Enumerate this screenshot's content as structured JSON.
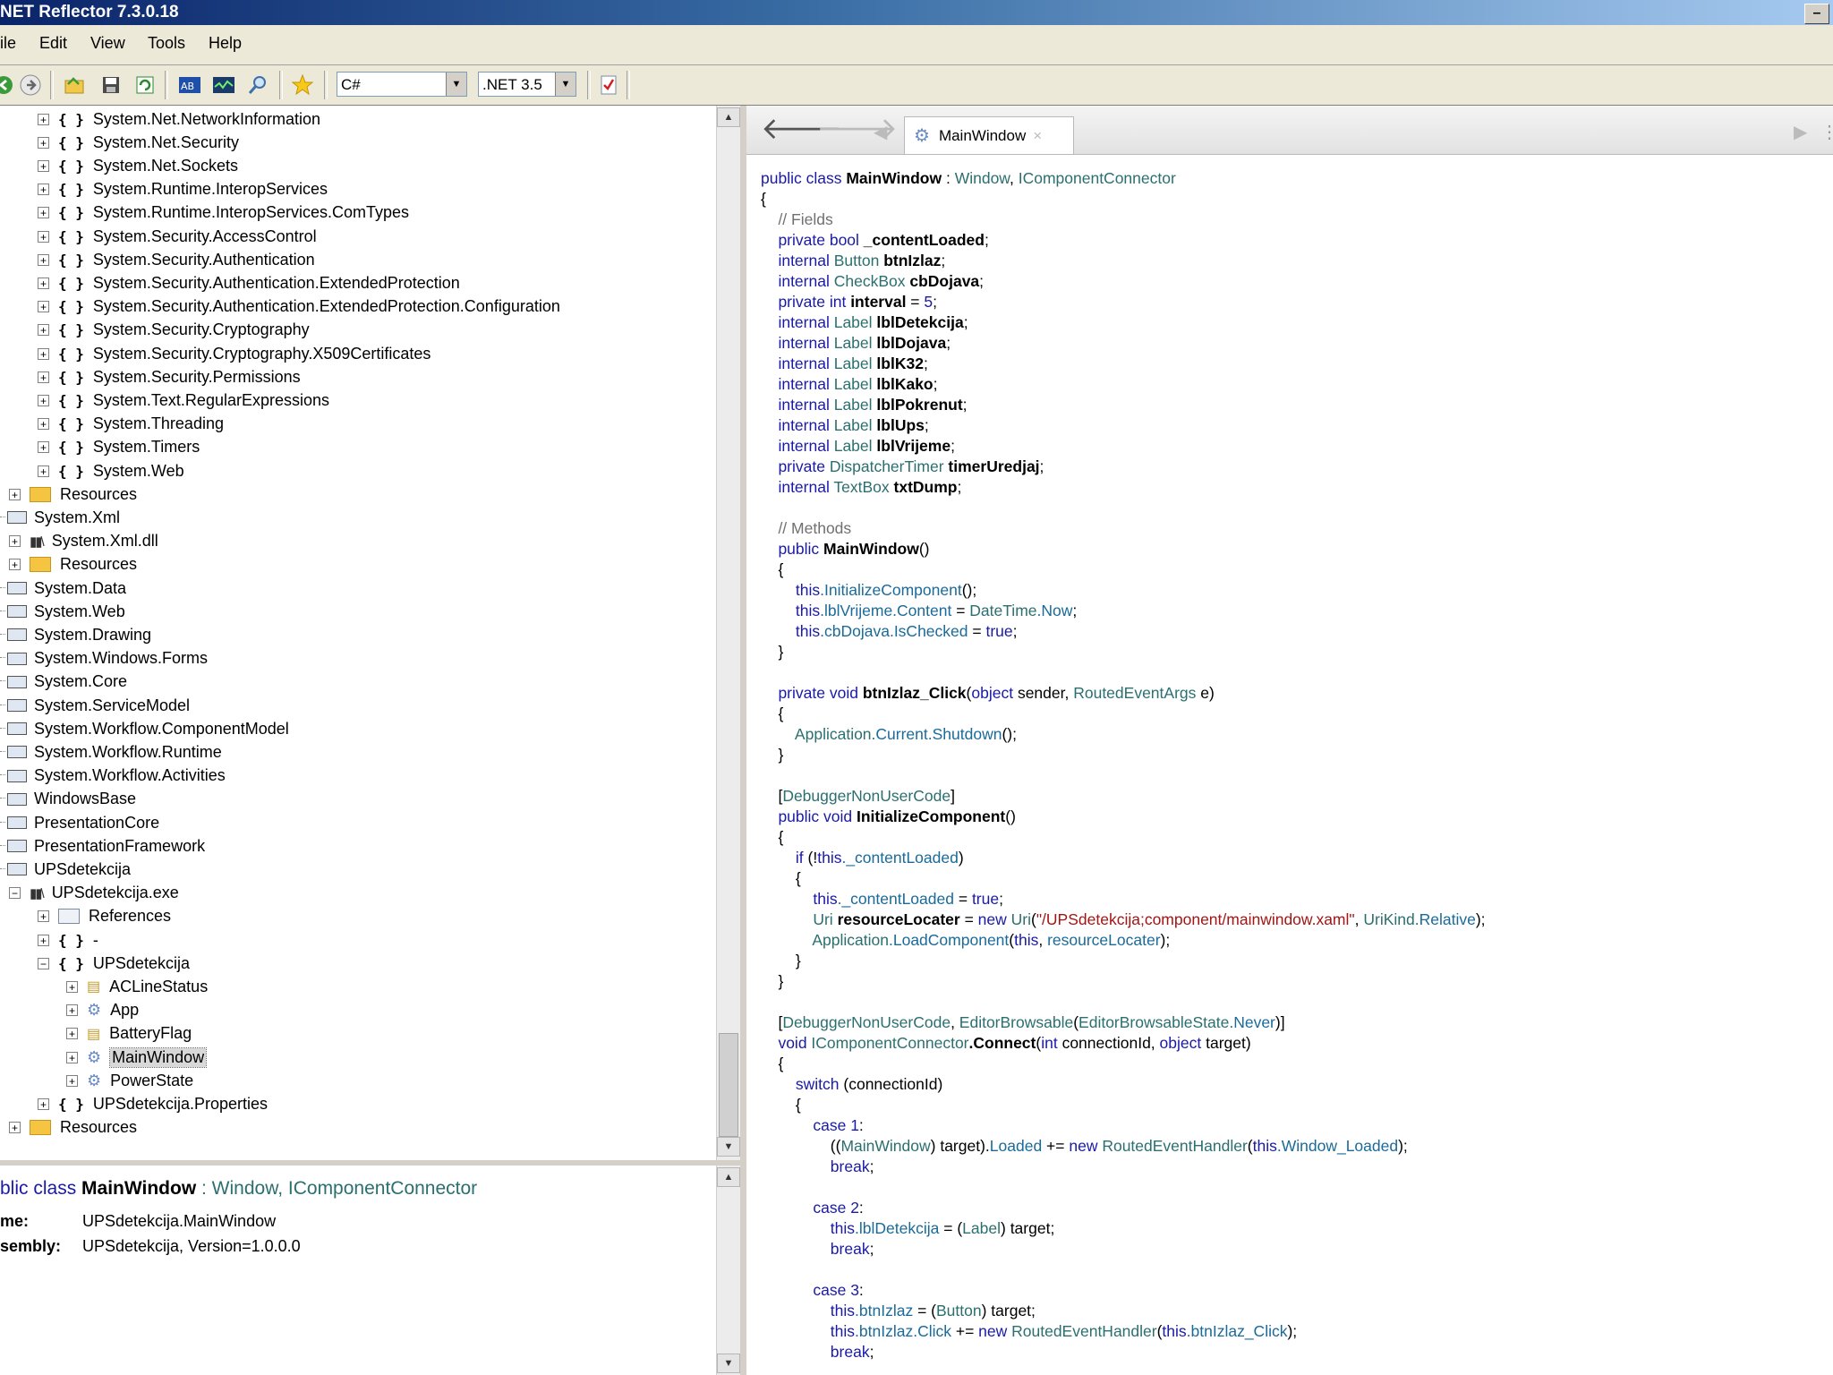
{
  "window": {
    "title": "NET Reflector 7.3.0.18",
    "minimize_glyph": "–",
    "maximize_glyph": "□"
  },
  "menu": [
    "ile",
    "Edit",
    "View",
    "Tools",
    "Help"
  ],
  "toolbar": {
    "icons": [
      "back-icon",
      "forward-icon",
      "open-icon",
      "save-icon",
      "refresh-icon",
      "disassemble-icon",
      "analyzer-icon",
      "search-icon",
      "bookmark-icon",
      "addin-icon"
    ],
    "language": "C#",
    "framework": ".NET 3.5",
    "combo_arrow": "▼"
  },
  "tree": {
    "items": [
      {
        "level": 2,
        "exp": "+",
        "icon": "namespace",
        "label": "System.Net.NetworkInformation"
      },
      {
        "level": 2,
        "exp": "+",
        "icon": "namespace",
        "label": "System.Net.Security"
      },
      {
        "level": 2,
        "exp": "+",
        "icon": "namespace",
        "label": "System.Net.Sockets"
      },
      {
        "level": 2,
        "exp": "+",
        "icon": "namespace",
        "label": "System.Runtime.InteropServices"
      },
      {
        "level": 2,
        "exp": "+",
        "icon": "namespace",
        "label": "System.Runtime.InteropServices.ComTypes"
      },
      {
        "level": 2,
        "exp": "+",
        "icon": "namespace",
        "label": "System.Security.AccessControl"
      },
      {
        "level": 2,
        "exp": "+",
        "icon": "namespace",
        "label": "System.Security.Authentication"
      },
      {
        "level": 2,
        "exp": "+",
        "icon": "namespace",
        "label": "System.Security.Authentication.ExtendedProtection"
      },
      {
        "level": 2,
        "exp": "+",
        "icon": "namespace",
        "label": "System.Security.Authentication.ExtendedProtection.Configuration"
      },
      {
        "level": 2,
        "exp": "+",
        "icon": "namespace",
        "label": "System.Security.Cryptography"
      },
      {
        "level": 2,
        "exp": "+",
        "icon": "namespace",
        "label": "System.Security.Cryptography.X509Certificates"
      },
      {
        "level": 2,
        "exp": "+",
        "icon": "namespace",
        "label": "System.Security.Permissions"
      },
      {
        "level": 2,
        "exp": "+",
        "icon": "namespace",
        "label": "System.Text.RegularExpressions"
      },
      {
        "level": 2,
        "exp": "+",
        "icon": "namespace",
        "label": "System.Threading"
      },
      {
        "level": 2,
        "exp": "+",
        "icon": "namespace",
        "label": "System.Timers"
      },
      {
        "level": 2,
        "exp": "+",
        "icon": "namespace",
        "label": "System.Web"
      },
      {
        "level": 1,
        "exp": "+",
        "icon": "folder",
        "label": "Resources"
      },
      {
        "level": 0,
        "exp": "",
        "icon": "assembly",
        "label": "System.Xml"
      },
      {
        "level": 1,
        "exp": "+",
        "icon": "library",
        "label": "System.Xml.dll"
      },
      {
        "level": 1,
        "exp": "+",
        "icon": "folder",
        "label": "Resources"
      },
      {
        "level": 0,
        "exp": "",
        "icon": "assembly",
        "label": "System.Data"
      },
      {
        "level": 0,
        "exp": "",
        "icon": "assembly",
        "label": "System.Web"
      },
      {
        "level": 0,
        "exp": "",
        "icon": "assembly",
        "label": "System.Drawing"
      },
      {
        "level": 0,
        "exp": "",
        "icon": "assembly",
        "label": "System.Windows.Forms"
      },
      {
        "level": 0,
        "exp": "",
        "icon": "assembly",
        "label": "System.Core"
      },
      {
        "level": 0,
        "exp": "",
        "icon": "assembly",
        "label": "System.ServiceModel"
      },
      {
        "level": 0,
        "exp": "",
        "icon": "assembly",
        "label": "System.Workflow.ComponentModel"
      },
      {
        "level": 0,
        "exp": "",
        "icon": "assembly",
        "label": "System.Workflow.Runtime"
      },
      {
        "level": 0,
        "exp": "",
        "icon": "assembly",
        "label": "System.Workflow.Activities"
      },
      {
        "level": 0,
        "exp": "",
        "icon": "assembly",
        "label": "WindowsBase"
      },
      {
        "level": 0,
        "exp": "",
        "icon": "assembly",
        "label": "PresentationCore"
      },
      {
        "level": 0,
        "exp": "",
        "icon": "assembly",
        "label": "PresentationFramework"
      },
      {
        "level": 0,
        "exp": "",
        "icon": "assembly",
        "label": "UPSdetekcija"
      },
      {
        "level": 1,
        "exp": "−",
        "icon": "library",
        "label": "UPSdetekcija.exe"
      },
      {
        "level": 2,
        "exp": "+",
        "icon": "references",
        "label": "References"
      },
      {
        "level": 2,
        "exp": "+",
        "icon": "namespace",
        "label": "-"
      },
      {
        "level": 2,
        "exp": "−",
        "icon": "namespace",
        "label": "UPSdetekcija"
      },
      {
        "level": 3,
        "exp": "+",
        "icon": "enum",
        "label": "ACLineStatus"
      },
      {
        "level": 3,
        "exp": "+",
        "icon": "class",
        "label": "App"
      },
      {
        "level": 3,
        "exp": "+",
        "icon": "enum",
        "label": "BatteryFlag"
      },
      {
        "level": 3,
        "exp": "+",
        "icon": "class",
        "label": "MainWindow",
        "selected": true
      },
      {
        "level": 3,
        "exp": "+",
        "icon": "class",
        "label": "PowerState"
      },
      {
        "level": 2,
        "exp": "+",
        "icon": "namespace",
        "label": "UPSdetekcija.Properties"
      },
      {
        "level": 1,
        "exp": "+",
        "icon": "folder",
        "label": "Resources"
      }
    ]
  },
  "info": {
    "decl_kw": "blic class",
    "decl_name": "MainWindow",
    "decl_rest": " : Window, IComponentConnector",
    "name_label": "me:",
    "name_value": "UPSdetekcija.MainWindow",
    "assembly_label": "sembly:",
    "assembly_value": "UPSdetekcija, Version=1.0.0.0"
  },
  "tab": {
    "label": "MainWindow",
    "close": "×"
  },
  "nav": {
    "back": "🡐",
    "forward": "🡒",
    "left": "◀",
    "right": "▶",
    "end": "⋮"
  },
  "scrollbar": {
    "up": "▲",
    "down": "▼"
  },
  "code": [
    [
      [
        "kw",
        "public class "
      ],
      [
        "b",
        "MainWindow"
      ],
      [
        "",
        " : "
      ],
      [
        "ty",
        "Window"
      ],
      [
        "",
        ", "
      ],
      [
        "ty",
        "IComponentConnector"
      ]
    ],
    [
      [
        "",
        "{"
      ]
    ],
    [
      [
        "cm",
        "    // Fields"
      ]
    ],
    [
      [
        "kw",
        "    private bool "
      ],
      [
        "b",
        "_contentLoaded"
      ],
      [
        "",
        ";"
      ]
    ],
    [
      [
        "kw",
        "    internal "
      ],
      [
        "ty",
        "Button "
      ],
      [
        "b",
        "btnIzlaz"
      ],
      [
        "",
        ";"
      ]
    ],
    [
      [
        "kw",
        "    internal "
      ],
      [
        "ty",
        "CheckBox "
      ],
      [
        "b",
        "cbDojava"
      ],
      [
        "",
        ";"
      ]
    ],
    [
      [
        "kw",
        "    private int "
      ],
      [
        "b",
        "interval"
      ],
      [
        "",
        " = "
      ],
      [
        "kw",
        "5"
      ],
      [
        "",
        ";"
      ]
    ],
    [
      [
        "kw",
        "    internal "
      ],
      [
        "ty",
        "Label "
      ],
      [
        "b",
        "lblDetekcija"
      ],
      [
        "",
        ";"
      ]
    ],
    [
      [
        "kw",
        "    internal "
      ],
      [
        "ty",
        "Label "
      ],
      [
        "b",
        "lblDojava"
      ],
      [
        "",
        ";"
      ]
    ],
    [
      [
        "kw",
        "    internal "
      ],
      [
        "ty",
        "Label "
      ],
      [
        "b",
        "lblK32"
      ],
      [
        "",
        ";"
      ]
    ],
    [
      [
        "kw",
        "    internal "
      ],
      [
        "ty",
        "Label "
      ],
      [
        "b",
        "lblKako"
      ],
      [
        "",
        ";"
      ]
    ],
    [
      [
        "kw",
        "    internal "
      ],
      [
        "ty",
        "Label "
      ],
      [
        "b",
        "lblPokrenut"
      ],
      [
        "",
        ";"
      ]
    ],
    [
      [
        "kw",
        "    internal "
      ],
      [
        "ty",
        "Label "
      ],
      [
        "b",
        "lblUps"
      ],
      [
        "",
        ";"
      ]
    ],
    [
      [
        "kw",
        "    internal "
      ],
      [
        "ty",
        "Label "
      ],
      [
        "b",
        "lblVrijeme"
      ],
      [
        "",
        ";"
      ]
    ],
    [
      [
        "kw",
        "    private "
      ],
      [
        "ty",
        "DispatcherTimer "
      ],
      [
        "b",
        "timerUredjaj"
      ],
      [
        "",
        ";"
      ]
    ],
    [
      [
        "kw",
        "    internal "
      ],
      [
        "ty",
        "TextBox "
      ],
      [
        "b",
        "txtDump"
      ],
      [
        "",
        ";"
      ]
    ],
    [
      [
        "",
        ""
      ]
    ],
    [
      [
        "cm",
        "    // Methods"
      ]
    ],
    [
      [
        "kw",
        "    public "
      ],
      [
        "b",
        "MainWindow"
      ],
      [
        "",
        "()"
      ]
    ],
    [
      [
        "",
        "    {"
      ]
    ],
    [
      [
        "kw",
        "        this"
      ],
      [
        "tyb",
        ".InitializeComponent"
      ],
      [
        "",
        "();"
      ]
    ],
    [
      [
        "kw",
        "        this"
      ],
      [
        "tyb",
        ".lblVrijeme.Content"
      ],
      [
        "",
        " = "
      ],
      [
        "ty",
        "DateTime"
      ],
      [
        "tyb",
        ".Now"
      ],
      [
        "",
        ";"
      ]
    ],
    [
      [
        "kw",
        "        this"
      ],
      [
        "tyb",
        ".cbDojava.IsChecked"
      ],
      [
        "",
        " = "
      ],
      [
        "kw",
        "true"
      ],
      [
        "",
        ";"
      ]
    ],
    [
      [
        "",
        "    }"
      ]
    ],
    [
      [
        "",
        ""
      ]
    ],
    [
      [
        "kw",
        "    private void "
      ],
      [
        "b",
        "btnIzlaz_Click"
      ],
      [
        "",
        "("
      ],
      [
        "kw",
        "object "
      ],
      [
        "",
        "sender, "
      ],
      [
        "ty",
        "RoutedEventArgs "
      ],
      [
        "",
        "e)"
      ]
    ],
    [
      [
        "",
        "    {"
      ]
    ],
    [
      [
        "ty",
        "        Application"
      ],
      [
        "tyb",
        ".Current.Shutdown"
      ],
      [
        "",
        "();"
      ]
    ],
    [
      [
        "",
        "    }"
      ]
    ],
    [
      [
        "",
        ""
      ]
    ],
    [
      [
        "",
        "    ["
      ],
      [
        "ty",
        "DebuggerNonUserCode"
      ],
      [
        "",
        "]"
      ]
    ],
    [
      [
        "kw",
        "    public void "
      ],
      [
        "b",
        "InitializeComponent"
      ],
      [
        "",
        "()"
      ]
    ],
    [
      [
        "",
        "    {"
      ]
    ],
    [
      [
        "kw",
        "        if "
      ],
      [
        "",
        "(!"
      ],
      [
        "kw",
        "this"
      ],
      [
        "tyb",
        "._contentLoaded"
      ],
      [
        "",
        ")"
      ]
    ],
    [
      [
        "",
        "        {"
      ]
    ],
    [
      [
        "kw",
        "            this"
      ],
      [
        "tyb",
        "._contentLoaded"
      ],
      [
        "",
        " = "
      ],
      [
        "kw",
        "true"
      ],
      [
        "",
        ";"
      ]
    ],
    [
      [
        "ty",
        "            Uri "
      ],
      [
        "b",
        "resourceLocater"
      ],
      [
        "",
        " = "
      ],
      [
        "kw",
        "new "
      ],
      [
        "ty",
        "Uri"
      ],
      [
        "",
        "("
      ],
      [
        "st",
        "\"/UPSdetekcija;component/mainwindow.xaml\""
      ],
      [
        "",
        ", "
      ],
      [
        "ty",
        "UriKind"
      ],
      [
        "tyb",
        ".Relative"
      ],
      [
        "",
        ");"
      ]
    ],
    [
      [
        "ty",
        "            Application"
      ],
      [
        "tyb",
        ".LoadComponent"
      ],
      [
        "",
        "("
      ],
      [
        "kw",
        "this"
      ],
      [
        "",
        ", "
      ],
      [
        "tyb",
        "resourceLocater"
      ],
      [
        "",
        ");"
      ]
    ],
    [
      [
        "",
        "        }"
      ]
    ],
    [
      [
        "",
        "    }"
      ]
    ],
    [
      [
        "",
        ""
      ]
    ],
    [
      [
        "",
        "    ["
      ],
      [
        "ty",
        "DebuggerNonUserCode"
      ],
      [
        "",
        ", "
      ],
      [
        "ty",
        "EditorBrowsable"
      ],
      [
        "",
        "("
      ],
      [
        "ty",
        "EditorBrowsableState"
      ],
      [
        "tyb",
        ".Never"
      ],
      [
        "",
        ")]"
      ]
    ],
    [
      [
        "kw",
        "    void "
      ],
      [
        "ty",
        "IComponentConnector"
      ],
      [
        "b",
        ".Connect"
      ],
      [
        "",
        "("
      ],
      [
        "kw",
        "int "
      ],
      [
        "",
        "connectionId, "
      ],
      [
        "kw",
        "object "
      ],
      [
        "",
        "target)"
      ]
    ],
    [
      [
        "",
        "    {"
      ]
    ],
    [
      [
        "kw",
        "        switch "
      ],
      [
        "",
        "(connectionId)"
      ]
    ],
    [
      [
        "",
        "        {"
      ]
    ],
    [
      [
        "kw",
        "            case "
      ],
      [
        "kw",
        "1"
      ],
      [
        "",
        ":"
      ]
    ],
    [
      [
        "",
        "                (("
      ],
      [
        "ty",
        "MainWindow"
      ],
      [
        "",
        ") target)."
      ],
      [
        "tyb",
        "Loaded"
      ],
      [
        "",
        " += "
      ],
      [
        "kw",
        "new "
      ],
      [
        "ty",
        "RoutedEventHandler"
      ],
      [
        "",
        "("
      ],
      [
        "kw",
        "this"
      ],
      [
        "tyb",
        ".Window_Loaded"
      ],
      [
        "",
        ");"
      ]
    ],
    [
      [
        "kw",
        "                break"
      ],
      [
        "",
        ";"
      ]
    ],
    [
      [
        "",
        ""
      ]
    ],
    [
      [
        "kw",
        "            case "
      ],
      [
        "kw",
        "2"
      ],
      [
        "",
        ":"
      ]
    ],
    [
      [
        "kw",
        "                this"
      ],
      [
        "tyb",
        ".lblDetekcija"
      ],
      [
        "",
        " = ("
      ],
      [
        "ty",
        "Label"
      ],
      [
        "",
        ") target;"
      ]
    ],
    [
      [
        "kw",
        "                break"
      ],
      [
        "",
        ";"
      ]
    ],
    [
      [
        "",
        ""
      ]
    ],
    [
      [
        "kw",
        "            case "
      ],
      [
        "kw",
        "3"
      ],
      [
        "",
        ":"
      ]
    ],
    [
      [
        "kw",
        "                this"
      ],
      [
        "tyb",
        ".btnIzlaz"
      ],
      [
        "",
        " = ("
      ],
      [
        "ty",
        "Button"
      ],
      [
        "",
        ") target;"
      ]
    ],
    [
      [
        "kw",
        "                this"
      ],
      [
        "tyb",
        ".btnIzlaz.Click"
      ],
      [
        "",
        " += "
      ],
      [
        "kw",
        "new "
      ],
      [
        "ty",
        "RoutedEventHandler"
      ],
      [
        "",
        "("
      ],
      [
        "kw",
        "this"
      ],
      [
        "tyb",
        ".btnIzlaz_Click"
      ],
      [
        "",
        ");"
      ]
    ],
    [
      [
        "kw",
        "                break"
      ],
      [
        "",
        ";"
      ]
    ]
  ]
}
